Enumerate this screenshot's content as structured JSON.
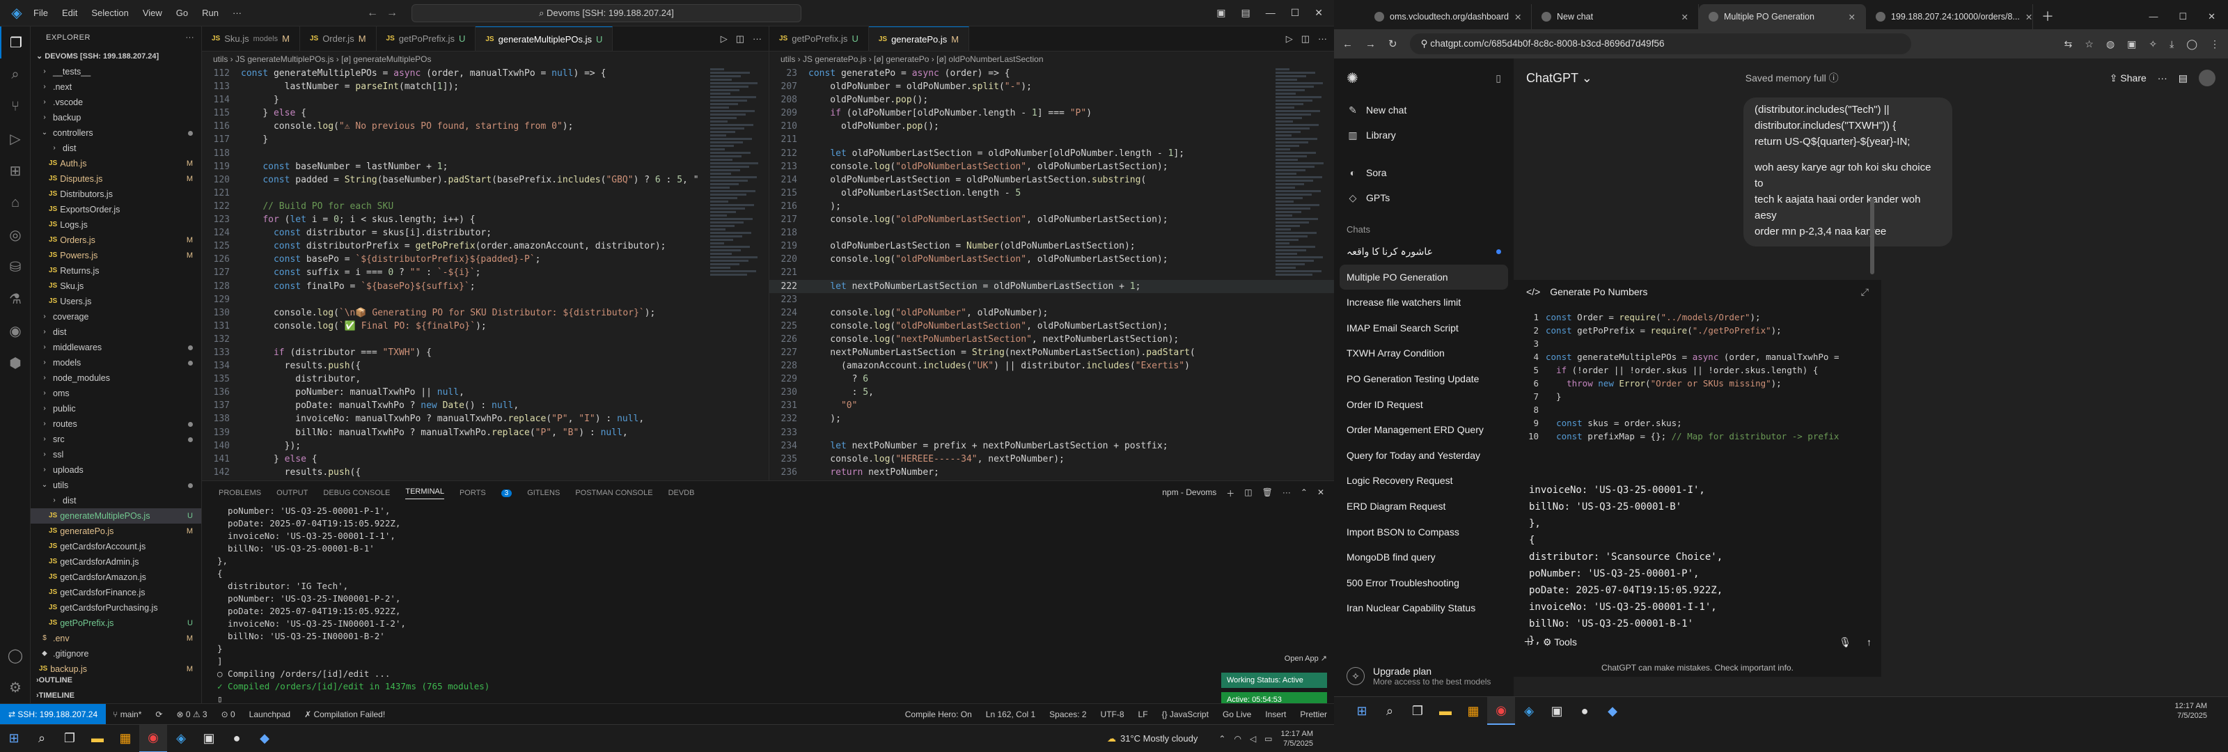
{
  "vscode": {
    "menu": [
      "File",
      "Edit",
      "Selection",
      "View",
      "Go",
      "Run"
    ],
    "command_center": "Devoms [SSH: 199.188.207.24]",
    "explorer_title": "EXPLORER",
    "project": "DEVOMS [SSH: 199.188.207.24]",
    "tree": [
      {
        "i": "›",
        "n": "__tests__",
        "t": "folder"
      },
      {
        "i": "›",
        "n": ".next",
        "t": "folder"
      },
      {
        "i": "›",
        "n": ".vscode",
        "t": "folder"
      },
      {
        "i": "›",
        "n": "backup",
        "t": "folder"
      },
      {
        "i": "⌄",
        "n": "controllers",
        "t": "folder",
        "m": "dot"
      },
      {
        "i": "›",
        "n": "dist",
        "t": "folder",
        "ind": 1
      },
      {
        "i": "JS",
        "n": "Auth.js",
        "t": "mod",
        "m": "M",
        "ind": 1
      },
      {
        "i": "JS",
        "n": "Disputes.js",
        "t": "mod",
        "m": "M",
        "ind": 1
      },
      {
        "i": "JS",
        "n": "Distributors.js",
        "t": "file",
        "ind": 1
      },
      {
        "i": "JS",
        "n": "ExportsOrder.js",
        "t": "file",
        "ind": 1
      },
      {
        "i": "JS",
        "n": "Logs.js",
        "t": "file",
        "ind": 1
      },
      {
        "i": "JS",
        "n": "Orders.js",
        "t": "mod",
        "m": "M",
        "ind": 1
      },
      {
        "i": "JS",
        "n": "Powers.js",
        "t": "mod",
        "m": "M",
        "ind": 1
      },
      {
        "i": "JS",
        "n": "Returns.js",
        "t": "file",
        "ind": 1
      },
      {
        "i": "JS",
        "n": "Sku.js",
        "t": "file",
        "ind": 1
      },
      {
        "i": "JS",
        "n": "Users.js",
        "t": "file",
        "ind": 1
      },
      {
        "i": "›",
        "n": "coverage",
        "t": "folder"
      },
      {
        "i": "›",
        "n": "dist",
        "t": "folder"
      },
      {
        "i": "›",
        "n": "middlewares",
        "t": "folder",
        "m": "dot"
      },
      {
        "i": "›",
        "n": "models",
        "t": "folder",
        "m": "dot"
      },
      {
        "i": "›",
        "n": "node_modules",
        "t": "folder"
      },
      {
        "i": "›",
        "n": "oms",
        "t": "folder"
      },
      {
        "i": "›",
        "n": "public",
        "t": "folder"
      },
      {
        "i": "›",
        "n": "routes",
        "t": "folder",
        "m": "dot"
      },
      {
        "i": "›",
        "n": "src",
        "t": "folder",
        "m": "dot"
      },
      {
        "i": "›",
        "n": "ssl",
        "t": "folder"
      },
      {
        "i": "›",
        "n": "uploads",
        "t": "folder"
      },
      {
        "i": "⌄",
        "n": "utils",
        "t": "folder",
        "m": "dot"
      },
      {
        "i": "›",
        "n": "dist",
        "t": "folder",
        "ind": 1
      },
      {
        "i": "JS",
        "n": "generateMultiplePOs.js",
        "t": "unt",
        "m": "U",
        "ind": 1,
        "sel": true
      },
      {
        "i": "JS",
        "n": "generatePo.js",
        "t": "mod",
        "m": "M",
        "ind": 1
      },
      {
        "i": "JS",
        "n": "getCardsforAccount.js",
        "t": "file",
        "ind": 1
      },
      {
        "i": "JS",
        "n": "getCardsforAdmin.js",
        "t": "file",
        "ind": 1
      },
      {
        "i": "JS",
        "n": "getCardsforAmazon.js",
        "t": "file",
        "ind": 1
      },
      {
        "i": "JS",
        "n": "getCardsforFinance.js",
        "t": "file",
        "ind": 1
      },
      {
        "i": "JS",
        "n": "getCardsforPurchasing.js",
        "t": "file",
        "ind": 1
      },
      {
        "i": "JS",
        "n": "getPoPrefix.js",
        "t": "unt",
        "m": "U",
        "ind": 1
      },
      {
        "i": "$",
        "n": ".env",
        "t": "mod",
        "m": "M"
      },
      {
        "i": "◆",
        "n": ".gitignore",
        "t": "file"
      },
      {
        "i": "JS",
        "n": "backup.js",
        "t": "mod",
        "m": "M"
      }
    ],
    "outline": "OUTLINE",
    "timeline": "TIMELINE",
    "ed1_tabs": [
      {
        "n": "Sku.js",
        "sub": "models",
        "m": "M"
      },
      {
        "n": "Order.js",
        "m": "M"
      },
      {
        "n": "getPoPrefix.js",
        "m": "U"
      },
      {
        "n": "generateMultiplePOs.js",
        "m": "U",
        "active": true
      }
    ],
    "ed2_tabs": [
      {
        "n": "getPoPrefix.js",
        "m": "U"
      },
      {
        "n": "generatePo.js",
        "m": "M",
        "active": true
      }
    ],
    "ed1_crumb": "utils › JS generateMultiplePOs.js › [ø] generateMultiplePOs",
    "ed2_crumb": "utils › JS generatePo.js › [ø] generatePo › [ø] oldPoNumberLastSection",
    "ed1_code": [
      {
        "n": "112",
        "c": "const generateMultiplePOs = async (order, manualTxwhPo = null) => {"
      },
      {
        "n": "113",
        "c": "        lastNumber = parseInt(match[1]);"
      },
      {
        "n": "114",
        "c": "      }"
      },
      {
        "n": "115",
        "c": "    } else {"
      },
      {
        "n": "116",
        "c": "      console.log(\"⚠ No previous PO found, starting from 0\");"
      },
      {
        "n": "117",
        "c": "    }"
      },
      {
        "n": "118",
        "c": ""
      },
      {
        "n": "119",
        "c": "    const baseNumber = lastNumber + 1;"
      },
      {
        "n": "120",
        "c": "    const padded = String(baseNumber).padStart(basePrefix.includes(\"GBQ\") ? 6 : 5, \""
      },
      {
        "n": "121",
        "c": ""
      },
      {
        "n": "122",
        "c": "    // Build PO for each SKU"
      },
      {
        "n": "123",
        "c": "    for (let i = 0; i < skus.length; i++) {"
      },
      {
        "n": "124",
        "c": "      const distributor = skus[i].distributor;"
      },
      {
        "n": "125",
        "c": "      const distributorPrefix = getPoPrefix(order.amazonAccount, distributor);"
      },
      {
        "n": "126",
        "c": "      const basePo = `${distributorPrefix}${padded}-P`;"
      },
      {
        "n": "127",
        "c": "      const suffix = i === 0 ? \"\" : `-${i}`;"
      },
      {
        "n": "128",
        "c": "      const finalPo = `${basePo}${suffix}`;"
      },
      {
        "n": "129",
        "c": ""
      },
      {
        "n": "130",
        "c": "      console.log(`\\n📦 Generating PO for SKU Distributor: ${distributor}`);"
      },
      {
        "n": "131",
        "c": "      console.log(`✅ Final PO: ${finalPo}`);"
      },
      {
        "n": "132",
        "c": ""
      },
      {
        "n": "133",
        "c": "      if (distributor === \"TXWH\") {"
      },
      {
        "n": "134",
        "c": "        results.push({"
      },
      {
        "n": "135",
        "c": "          distributor,"
      },
      {
        "n": "136",
        "c": "          poNumber: manualTxwhPo || null,"
      },
      {
        "n": "137",
        "c": "          poDate: manualTxwhPo ? new Date() : null,"
      },
      {
        "n": "138",
        "c": "          invoiceNo: manualTxwhPo ? manualTxwhPo.replace(\"P\", \"I\") : null,"
      },
      {
        "n": "139",
        "c": "          billNo: manualTxwhPo ? manualTxwhPo.replace(\"P\", \"B\") : null,"
      },
      {
        "n": "140",
        "c": "        });"
      },
      {
        "n": "141",
        "c": "      } else {"
      },
      {
        "n": "142",
        "c": "        results.push({"
      }
    ],
    "ed2_code": [
      {
        "n": "23",
        "c": "const generatePo = async (order) => {"
      },
      {
        "n": "207",
        "c": "    oldPoNumber = oldPoNumber.split(\"-\");"
      },
      {
        "n": "208",
        "c": "    oldPoNumber.pop();"
      },
      {
        "n": "209",
        "c": "    if (oldPoNumber[oldPoNumber.length - 1] === \"P\")"
      },
      {
        "n": "210",
        "c": "      oldPoNumber.pop();"
      },
      {
        "n": "211",
        "c": ""
      },
      {
        "n": "212",
        "c": "    let oldPoNumberLastSection = oldPoNumber[oldPoNumber.length - 1];"
      },
      {
        "n": "213",
        "c": "    console.log(\"oldPoNumberLastSection\", oldPoNumberLastSection);"
      },
      {
        "n": "214",
        "c": "    oldPoNumberLastSection = oldPoNumberLastSection.substring("
      },
      {
        "n": "215",
        "c": "      oldPoNumberLastSection.length - 5"
      },
      {
        "n": "216",
        "c": "    );"
      },
      {
        "n": "217",
        "c": "    console.log(\"oldPoNumberLastSection\", oldPoNumberLastSection);"
      },
      {
        "n": "218",
        "c": ""
      },
      {
        "n": "219",
        "c": "    oldPoNumberLastSection = Number(oldPoNumberLastSection);"
      },
      {
        "n": "220",
        "c": "    console.log(\"oldPoNumberLastSection\", oldPoNumberLastSection);"
      },
      {
        "n": "221",
        "c": ""
      },
      {
        "n": "222",
        "c": "    let nextPoNumberLastSection = oldPoNumberLastSection + 1;",
        "cur": true
      },
      {
        "n": "223",
        "c": ""
      },
      {
        "n": "224",
        "c": "    console.log(\"oldPoNumber\", oldPoNumber);"
      },
      {
        "n": "225",
        "c": "    console.log(\"oldPoNumberLastSection\", oldPoNumberLastSection);"
      },
      {
        "n": "226",
        "c": "    console.log(\"nextPoNumberLastSection\", nextPoNumberLastSection);"
      },
      {
        "n": "227",
        "c": "    nextPoNumberLastSection = String(nextPoNumberLastSection).padStart("
      },
      {
        "n": "228",
        "c": "      (amazonAccount.includes(\"UK\") || distributor.includes(\"Exertis\")"
      },
      {
        "n": "229",
        "c": "        ? 6"
      },
      {
        "n": "230",
        "c": "        : 5,"
      },
      {
        "n": "231",
        "c": "      \"0\""
      },
      {
        "n": "232",
        "c": "    );"
      },
      {
        "n": "233",
        "c": ""
      },
      {
        "n": "234",
        "c": "    let nextPoNumber = prefix + nextPoNumberLastSection + postfix;"
      },
      {
        "n": "235",
        "c": "    console.log(\"HEREEE-----34\", nextPoNumber);"
      },
      {
        "n": "236",
        "c": "    return nextPoNumber;"
      }
    ],
    "panel_tabs": [
      "PROBLEMS",
      "OUTPUT",
      "DEBUG CONSOLE",
      "TERMINAL",
      "PORTS",
      "GITLENS",
      "POSTMAN CONSOLE",
      "DEVDB"
    ],
    "ports_badge": "3",
    "terminal_name": "npm - Devoms",
    "terminal": [
      "  poNumber: 'US-Q3-25-00001-P-1',",
      "  poDate: 2025-07-04T19:15:05.922Z,",
      "  invoiceNo: 'US-Q3-25-00001-I-1',",
      "  billNo: 'US-Q3-25-00001-B-1'",
      "},",
      "{",
      "  distributor: 'IG Tech',",
      "  poNumber: 'US-Q3-25-IN00001-P-2',",
      "  poDate: 2025-07-04T19:15:05.922Z,",
      "  invoiceNo: 'US-Q3-25-IN00001-I-2',",
      "  billNo: 'US-Q3-25-IN00001-B-2'",
      "}",
      "]",
      "○ Compiling /orders/[id]/edit ...",
      "✓ Compiled /orders/[id]/edit in 1437ms (765 modules)",
      "▯"
    ],
    "open_app": "Open App ↗",
    "status_badges": [
      {
        "t": "Working Status: Active",
        "c": "#1f7a5a"
      },
      {
        "t": "Active: 05:54:53",
        "c": "#1a8f3a"
      },
      {
        "t": "In Active: 01:28:24",
        "c": "#c0392b"
      }
    ],
    "statusbar": {
      "remote": "⇄ SSH: 199.188.207.24",
      "left": [
        "⑂ main*",
        "⟳",
        "⊗ 0 ⚠ 3",
        "⊙ 0",
        "Launchpad",
        "✗ Compilation Failed!"
      ],
      "right": [
        "Compile Hero: On",
        "Ln 162, Col 1",
        "Spaces: 2",
        "UTF-8",
        "LF",
        "{} JavaScript",
        "Go Live",
        "Insert",
        "Prettier"
      ]
    }
  },
  "chrome": {
    "tabs": [
      {
        "t": "oms.vcloudtech.org/dashboard"
      },
      {
        "t": "New chat"
      },
      {
        "t": "Multiple PO Generation",
        "active": true
      },
      {
        "t": "199.188.207.24:10000/orders/8..."
      }
    ],
    "url": "chatgpt.com/c/685d4b0f-8c8c-8008-b3cd-8696d7d49f56"
  },
  "chatgpt": {
    "nav": [
      {
        "i": "✎",
        "t": "New chat"
      },
      {
        "i": "▥",
        "t": "Library"
      },
      {
        "i": "◐",
        "t": "Sora"
      },
      {
        "i": "◇",
        "t": "GPTs"
      }
    ],
    "chats_label": "Chats",
    "chats": [
      {
        "t": "عاشورہ کرنا کا واقعہ",
        "dot": true
      },
      {
        "t": "Multiple PO Generation",
        "on": true
      },
      {
        "t": "Increase file watchers limit"
      },
      {
        "t": "IMAP Email Search Script"
      },
      {
        "t": "TXWH Array Condition"
      },
      {
        "t": "PO Generation Testing Update"
      },
      {
        "t": "Order ID Request"
      },
      {
        "t": "Order Management ERD Query"
      },
      {
        "t": "Query for Today and Yesterday"
      },
      {
        "t": "Logic Recovery Request"
      },
      {
        "t": "ERD Diagram Request"
      },
      {
        "t": "Import BSON to Compass"
      },
      {
        "t": "MongoDB find query"
      },
      {
        "t": "500 Error Troubleshooting"
      },
      {
        "t": "Iran Nuclear Capability Status"
      }
    ],
    "upgrade_title": "Upgrade plan",
    "upgrade_sub": "More access to the best models",
    "header_title": "ChatGPT ⌄",
    "memory": "Saved memory full ⓘ",
    "share": "Share",
    "bubble": [
      "(distributor.includes(\"Tech\") ||",
      "distributor.includes(\"TXWH\")) {",
      "  return US-Q${quarter}-${year}-IN;",
      "",
      "woh aesy karye agr toh koi sku choice to",
      "tech k aajata haai order kander woh aesy",
      "order mn p-2,3,4 naa karyee"
    ],
    "canvas_title": "Generate Po Numbers",
    "canvas_code": [
      {
        "n": "1",
        "c": "const Order = require(\"../models/Order\");"
      },
      {
        "n": "2",
        "c": "const getPoPrefix = require(\"./getPoPrefix\");"
      },
      {
        "n": "3",
        "c": ""
      },
      {
        "n": "4",
        "c": "const generateMultiplePOs = async (order, manualTxwhPo ="
      },
      {
        "n": "5",
        "c": "  if (!order || !order.skus || !order.skus.length) {"
      },
      {
        "n": "6",
        "c": "    throw new Error(\"Order or SKUs missing\");"
      },
      {
        "n": "7",
        "c": "  }"
      },
      {
        "n": "8",
        "c": ""
      },
      {
        "n": "9",
        "c": "  const skus = order.skus;"
      },
      {
        "n": "10",
        "c": "  const prefixMap = {}; // Map for distributor -> prefix"
      }
    ],
    "output": [
      "invoiceNo: 'US-Q3-25-00001-I',",
      "billNo: 'US-Q3-25-00001-B'",
      "},",
      "{",
      "  distributor: 'Scansource Choice',",
      "  poNumber: 'US-Q3-25-00001-P',",
      "  poDate: 2025-07-04T19:15:05.922Z,",
      "  invoiceNo: 'US-Q3-25-00001-I-1',",
      "  billNo: 'US-Q3-25-00001-B-1'",
      "},"
    ],
    "composer_tools": "Tools",
    "disclaimer": "ChatGPT can make mistakes. Check important info."
  },
  "taskbar_left": {
    "weather": "31°C Mostly cloudy",
    "time": "12:17 AM",
    "date": "7/5/2025"
  },
  "taskbar_right": {
    "time": "12:17 AM",
    "date": "7/5/2025"
  }
}
